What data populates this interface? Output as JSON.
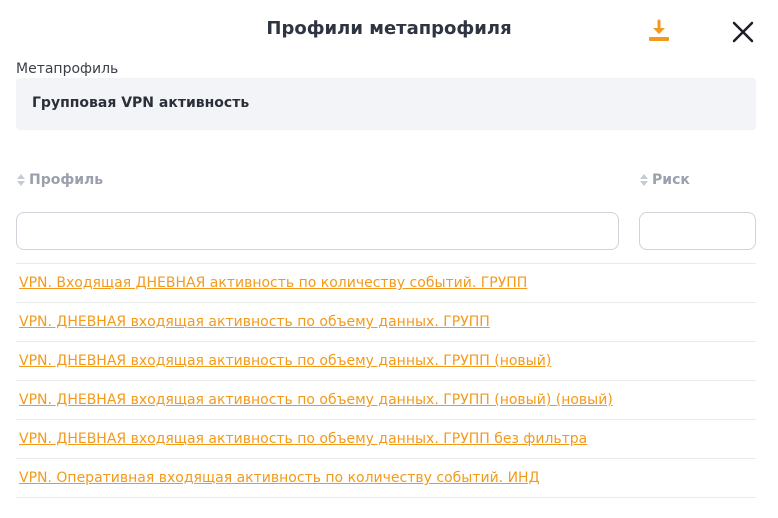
{
  "dialog": {
    "title": "Профили метапрофиля",
    "download_icon": "download-icon",
    "close_icon": "close-icon"
  },
  "metaprofile": {
    "label": "Метапрофиль",
    "value": "Групповая VPN активность"
  },
  "table": {
    "columns": [
      "Профиль",
      "Риск"
    ],
    "filters": {
      "profile_value": "",
      "risk_value": ""
    },
    "rows": [
      "VPN. Входящая ДНЕВНАЯ активность по количеству событий. ГРУПП",
      "VPN. ДНЕВНАЯ входящая активность по объему данных. ГРУПП",
      "VPN. ДНЕВНАЯ входящая активность по объему данных. ГРУПП (новый)",
      "VPN. ДНЕВНАЯ входящая активность по объему данных. ГРУПП (новый) (новый)",
      "VPN. ДНЕВНАЯ входящая активность по объему данных. ГРУПП без фильтра",
      "VPN. Оперативная входящая активность по количеству событий. ИНД"
    ]
  },
  "colors": {
    "accent": "#f39a1b",
    "header_text": "#9aa0ad",
    "field_bg": "#f2f4f7"
  }
}
